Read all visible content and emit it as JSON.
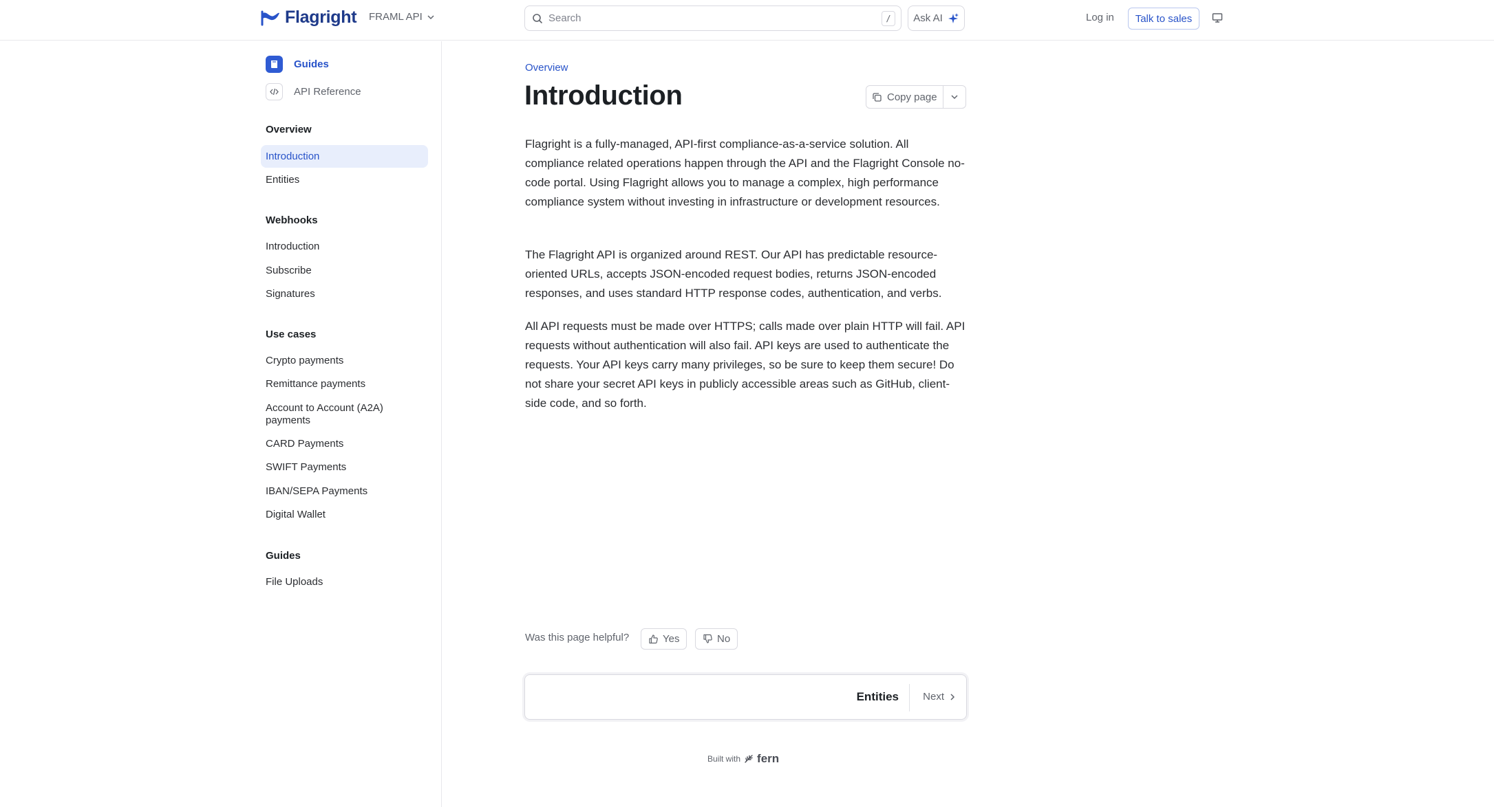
{
  "header": {
    "logo_text": "Flagright",
    "version_label": "FRAML API",
    "search_placeholder": "Search",
    "search_shortcut": "/",
    "ask_ai_label": "Ask AI",
    "login_label": "Log in",
    "talk_to_sales_label": "Talk to sales",
    "accent_color": "#2853c9"
  },
  "sidebar": {
    "top_links": [
      {
        "label": "Guides",
        "icon": "book-icon",
        "active": true
      },
      {
        "label": "API Reference",
        "icon": "code-icon",
        "active": false
      }
    ],
    "sections": [
      {
        "title": "Overview",
        "items": [
          "Introduction",
          "Entities"
        ]
      },
      {
        "title": "Webhooks",
        "items": [
          "Introduction",
          "Subscribe",
          "Signatures"
        ]
      },
      {
        "title": "Use cases",
        "items": [
          "Crypto payments",
          "Remittance payments",
          "Account to Account (A2A) payments",
          "CARD Payments",
          "SWIFT Payments",
          "IBAN/SEPA Payments",
          "Digital Wallet"
        ]
      },
      {
        "title": "Guides",
        "items": [
          "File Uploads"
        ]
      }
    ],
    "active_item": "Introduction"
  },
  "main": {
    "breadcrumb": "Overview",
    "title": "Introduction",
    "copy_page_label": "Copy page",
    "paragraphs": [
      "Flagright is a fully-managed, API-first compliance-as-a-service solution. All compliance related operations happen through the API and the Flagright Console no-code portal. Using Flagright allows you to manage a complex, high performance compliance system without investing in infrastructure or development resources.",
      "The Flagright API is organized around REST. Our API has predictable resource-oriented URLs, accepts JSON-encoded request bodies, returns JSON-encoded responses, and uses standard HTTP response codes, authentication, and verbs.",
      "All API requests must be made over HTTPS; calls made over plain HTTP will fail. API requests without authentication will also fail. API keys are used to authenticate the requests. Your API keys carry many privileges, so be sure to keep them secure! Do not share your secret API keys in publicly accessible areas such as GitHub, client-side code, and so forth."
    ],
    "feedback": {
      "question": "Was this page helpful?",
      "yes_label": "Yes",
      "no_label": "No"
    },
    "next": {
      "title": "Entities",
      "label": "Next"
    },
    "footer": {
      "built_with": "Built with",
      "brand": "fern"
    }
  }
}
